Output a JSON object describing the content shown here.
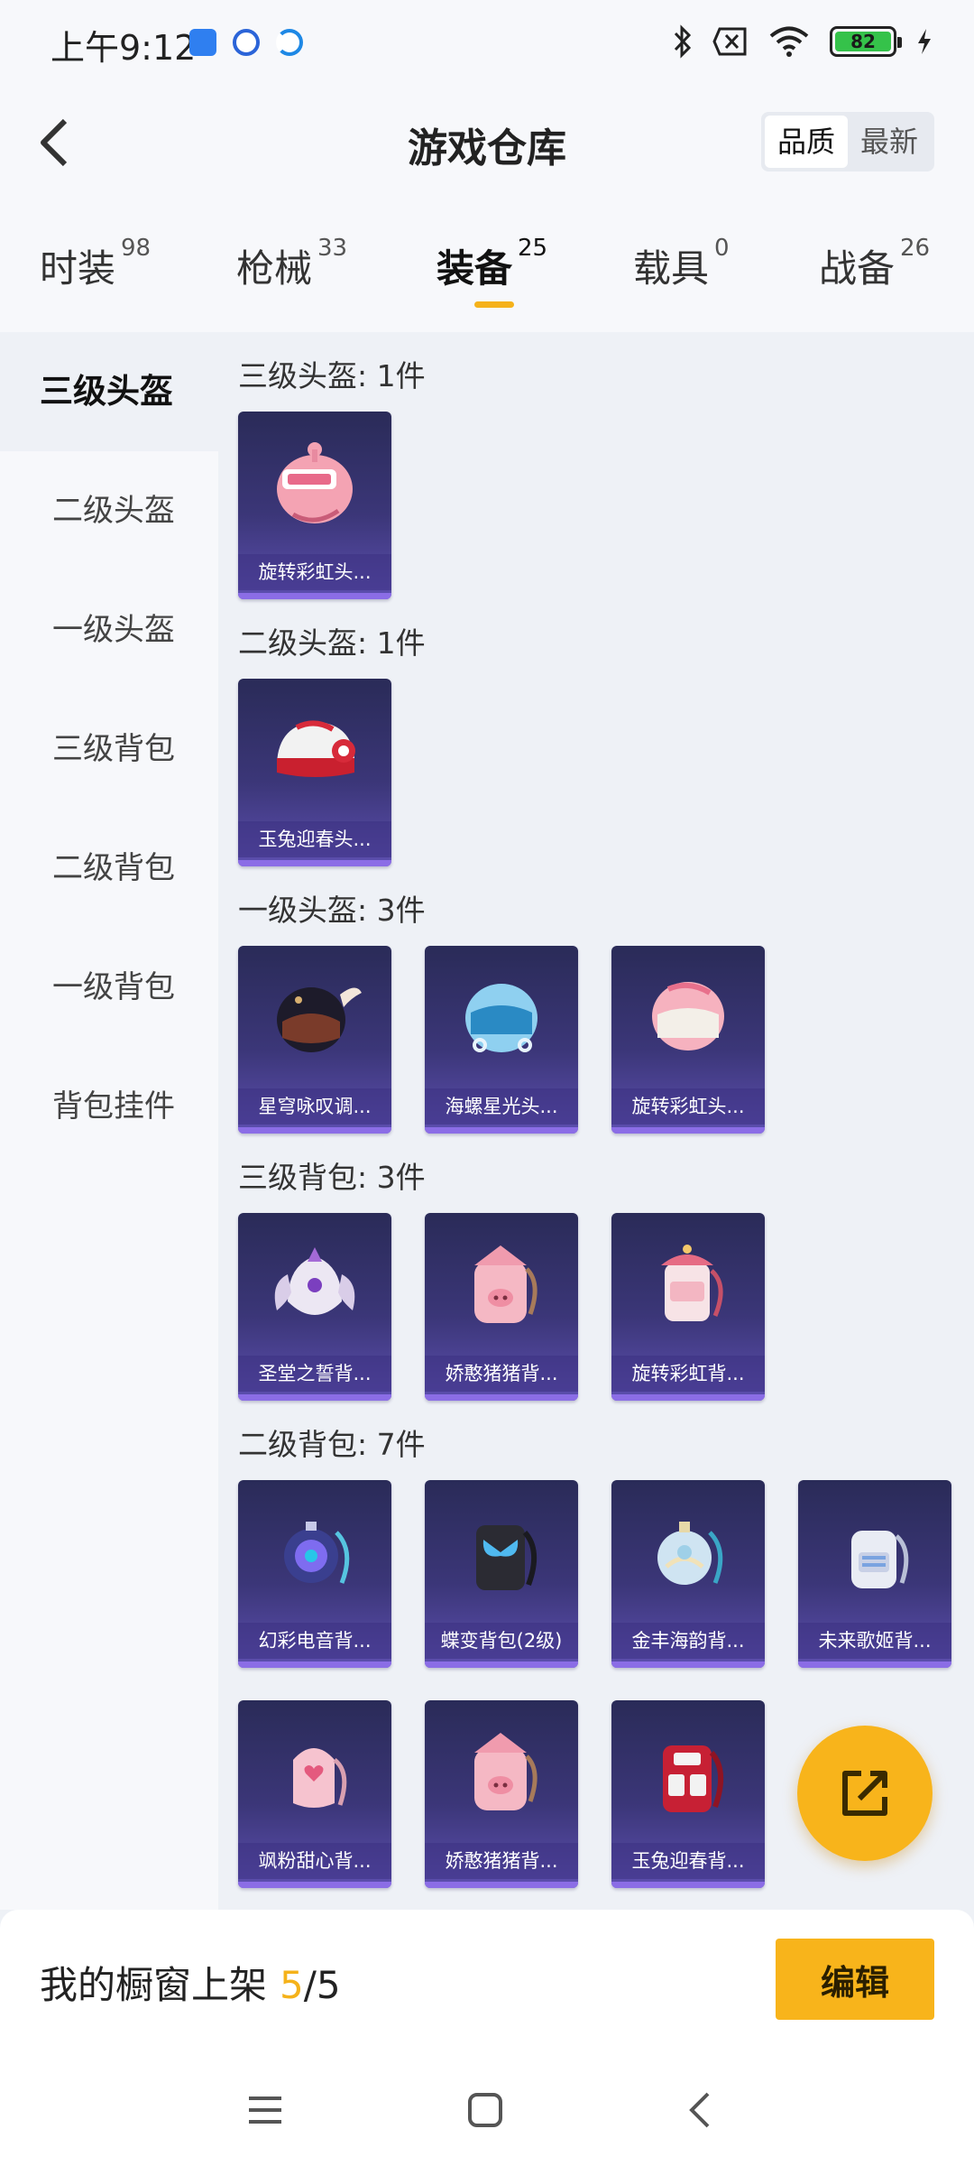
{
  "status_bar": {
    "time": "上午9:12",
    "battery": "82"
  },
  "header": {
    "title": "游戏仓库",
    "sort_options": [
      "品质",
      "最新"
    ],
    "sort_active": "品质"
  },
  "tabs": [
    {
      "label": "时装",
      "count": "98"
    },
    {
      "label": "枪械",
      "count": "33"
    },
    {
      "label": "装备",
      "count": "25",
      "active": true
    },
    {
      "label": "载具",
      "count": "0"
    },
    {
      "label": "战备",
      "count": "26"
    }
  ],
  "sidebar": {
    "items": [
      "三级头盔",
      "二级头盔",
      "一级头盔",
      "三级背包",
      "二级背包",
      "一级背包",
      "背包挂件"
    ],
    "active": "三级头盔"
  },
  "sections": [
    {
      "title": "三级头盔: 1件",
      "items": [
        {
          "name": "旋转彩虹头...",
          "icon": "pink-helmet-visor-icon"
        }
      ]
    },
    {
      "title": "二级头盔: 1件",
      "items": [
        {
          "name": "玉兔迎春头...",
          "icon": "red-white-helmet-icon"
        }
      ]
    },
    {
      "title": "一级头盔: 3件",
      "items": [
        {
          "name": "星穹咏叹调...",
          "icon": "dark-winged-helmet-icon"
        },
        {
          "name": "海螺星光头...",
          "icon": "blue-helmet-icon"
        },
        {
          "name": "旋转彩虹头...",
          "icon": "pink-helmet-icon"
        }
      ]
    },
    {
      "title": "三级背包: 3件",
      "items": [
        {
          "name": "圣堂之誓背...",
          "icon": "winged-backpack-icon"
        },
        {
          "name": "娇憨猪猪背...",
          "icon": "pig-backpack-icon"
        },
        {
          "name": "旋转彩虹背...",
          "icon": "carousel-backpack-icon"
        }
      ]
    },
    {
      "title": "二级背包: 7件",
      "items": [
        {
          "name": "幻彩电音背...",
          "icon": "round-speaker-backpack-icon"
        },
        {
          "name": "蝶变背包(2级)",
          "icon": "butterfly-backpack-icon"
        },
        {
          "name": "金丰海韵背...",
          "icon": "globe-backpack-icon"
        },
        {
          "name": "未来歌姬背...",
          "icon": "white-backpack-icon"
        },
        {
          "name": "飒粉甜心背...",
          "icon": "pink-heart-backpack-icon"
        },
        {
          "name": "娇憨猪猪背...",
          "icon": "pig-backpack-icon"
        },
        {
          "name": "玉兔迎春背...",
          "icon": "red-backpack-icon"
        }
      ]
    }
  ],
  "bottom_bar": {
    "label": "我的橱窗上架",
    "count_current": "5",
    "count_total": "/5",
    "edit_label": "编辑"
  },
  "colors": {
    "accent": "#f8b41b",
    "card_bg": "#3b3678",
    "background": "#eef1f6"
  }
}
